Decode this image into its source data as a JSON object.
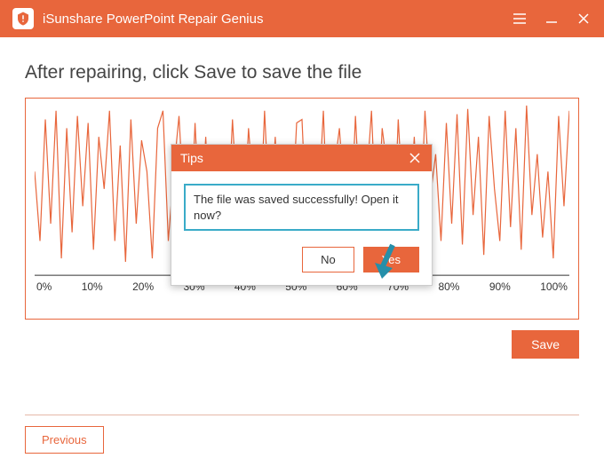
{
  "titlebar": {
    "app_title": "iSunshare PowerPoint Repair Genius"
  },
  "instruction": "After repairing, click Save to save the file",
  "dialog": {
    "title": "Tips",
    "message": "The file was saved successfully! Open it now?",
    "no_label": "No",
    "yes_label": "Yes"
  },
  "buttons": {
    "save": "Save",
    "previous": "Previous"
  },
  "colors": {
    "accent": "#e8663c",
    "highlight_border": "#3aabc8",
    "arrow": "#268fa9"
  },
  "chart_data": {
    "type": "line",
    "title": "",
    "xlabel": "",
    "ylabel": "",
    "ylim": [
      0,
      100
    ],
    "x_ticks": [
      "0%",
      "10%",
      "20%",
      "30%",
      "40%",
      "50%",
      "60%",
      "70%",
      "80%",
      "90%",
      "100%"
    ],
    "x": [
      0,
      1,
      2,
      3,
      4,
      5,
      6,
      7,
      8,
      9,
      10,
      11,
      12,
      13,
      14,
      15,
      16,
      17,
      18,
      19,
      20,
      21,
      22,
      23,
      24,
      25,
      26,
      27,
      28,
      29,
      30,
      31,
      32,
      33,
      34,
      35,
      36,
      37,
      38,
      39,
      40,
      41,
      42,
      43,
      44,
      45,
      46,
      47,
      48,
      49,
      50,
      51,
      52,
      53,
      54,
      55,
      56,
      57,
      58,
      59,
      60,
      61,
      62,
      63,
      64,
      65,
      66,
      67,
      68,
      69,
      70,
      71,
      72,
      73,
      74,
      75,
      76,
      77,
      78,
      79,
      80,
      81,
      82,
      83,
      84,
      85,
      86,
      87,
      88,
      89,
      90,
      91,
      92,
      93,
      94,
      95,
      96,
      97,
      98,
      99,
      100
    ],
    "values": [
      60,
      20,
      90,
      30,
      95,
      10,
      85,
      25,
      92,
      40,
      88,
      15,
      80,
      50,
      95,
      20,
      75,
      8,
      90,
      30,
      78,
      60,
      10,
      85,
      95,
      20,
      60,
      92,
      35,
      15,
      88,
      25,
      80,
      10,
      40,
      75,
      22,
      90,
      35,
      20,
      85,
      45,
      15,
      95,
      30,
      80,
      10,
      70,
      25,
      88,
      90,
      20,
      75,
      35,
      95,
      12,
      60,
      85,
      40,
      18,
      92,
      30,
      50,
      95,
      20,
      85,
      60,
      10,
      90,
      35,
      25,
      80,
      15,
      95,
      45,
      70,
      20,
      88,
      30,
      93,
      18,
      96,
      35,
      80,
      12,
      92,
      50,
      20,
      95,
      28,
      85,
      15,
      98,
      35,
      70,
      22,
      60,
      10,
      92,
      40,
      95
    ]
  }
}
